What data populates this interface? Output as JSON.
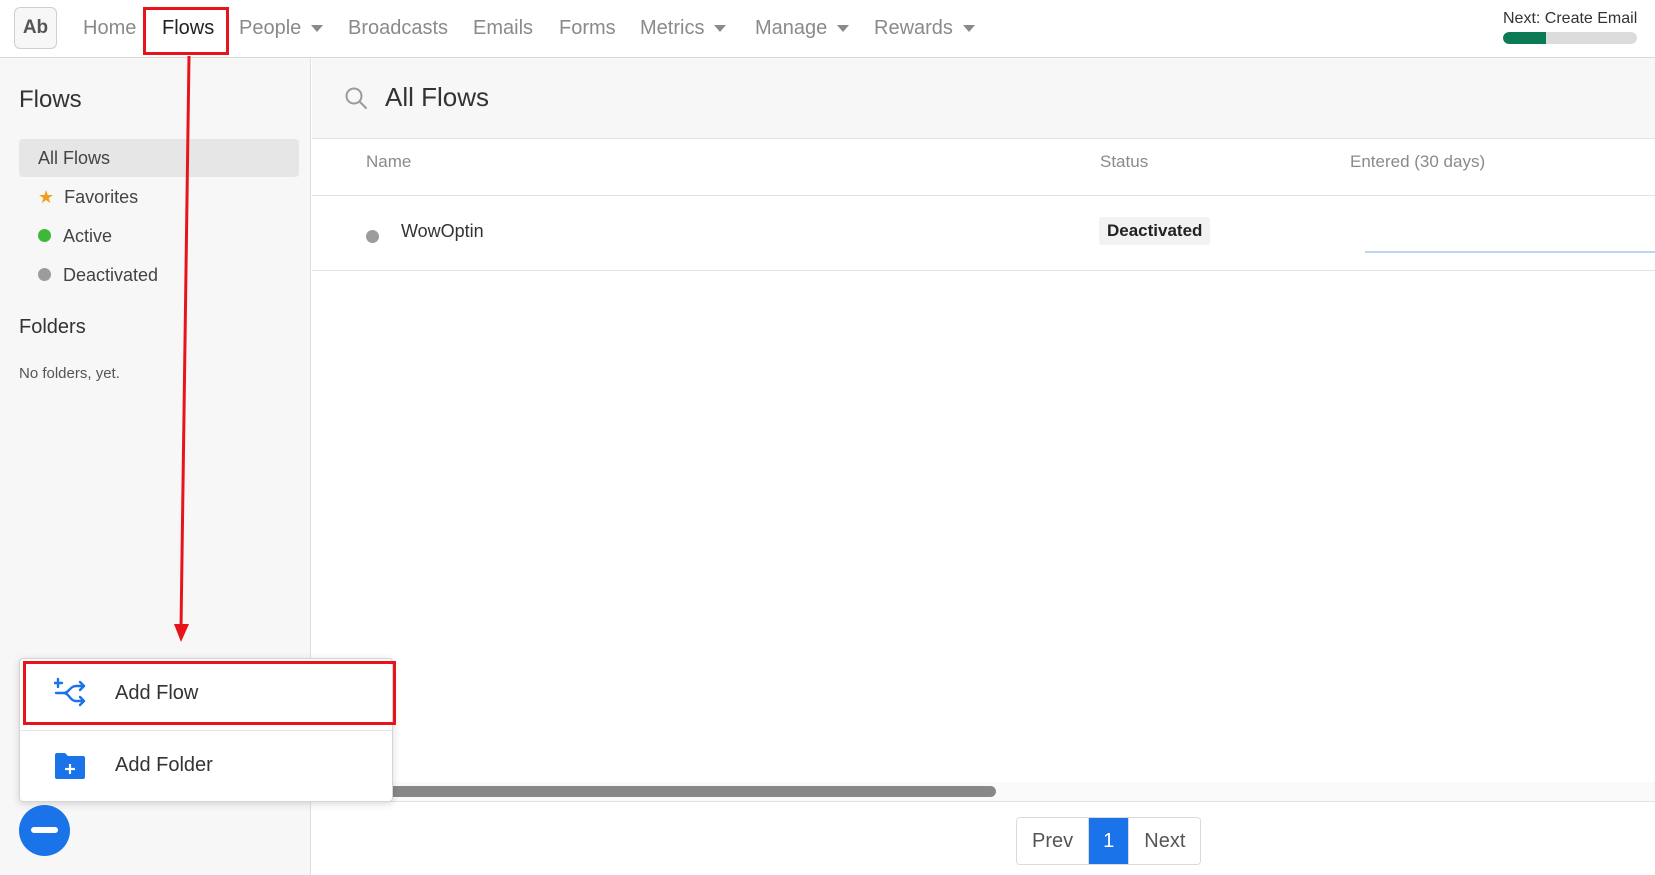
{
  "nav": {
    "logo": "Ab",
    "items": [
      {
        "label": "Home",
        "dropdown": false
      },
      {
        "label": "Flows",
        "dropdown": false,
        "active": true
      },
      {
        "label": "People",
        "dropdown": true
      },
      {
        "label": "Broadcasts",
        "dropdown": false
      },
      {
        "label": "Emails",
        "dropdown": false
      },
      {
        "label": "Forms",
        "dropdown": false
      },
      {
        "label": "Metrics",
        "dropdown": true
      },
      {
        "label": "Manage",
        "dropdown": true
      },
      {
        "label": "Rewards",
        "dropdown": true
      }
    ],
    "next_label": "Next: Create Email",
    "progress_fraction": 0.32,
    "progress_color": "#0b7a55"
  },
  "sidebar": {
    "title": "Flows",
    "items": [
      {
        "label": "All Flows",
        "selected": true,
        "icon": null
      },
      {
        "label": "Favorites",
        "icon": "star-icon",
        "color": "#f29b1d"
      },
      {
        "label": "Active",
        "icon": "status-dot-icon",
        "color": "#3db83a"
      },
      {
        "label": "Deactivated",
        "icon": "status-dot-icon",
        "color": "#9c9c9c"
      }
    ],
    "folders_title": "Folders",
    "no_folders": "No folders, yet."
  },
  "main": {
    "search_title": "All Flows",
    "columns": [
      "Name",
      "Status",
      "Entered (30 days)"
    ],
    "rows": [
      {
        "name": "WowOptin",
        "status": "Deactivated",
        "status_dot_color": "#9c9c9c"
      }
    ]
  },
  "pagination": {
    "prev": "Prev",
    "current": "1",
    "next": "Next"
  },
  "popup_menu": {
    "items": [
      {
        "label": "Add Flow",
        "icon": "add-flow-icon"
      },
      {
        "label": "Add Folder",
        "icon": "add-folder-icon"
      }
    ]
  },
  "fab": {
    "icon": "minus-icon",
    "color": "#1a73e8"
  },
  "annotation_color": "#e8141c"
}
